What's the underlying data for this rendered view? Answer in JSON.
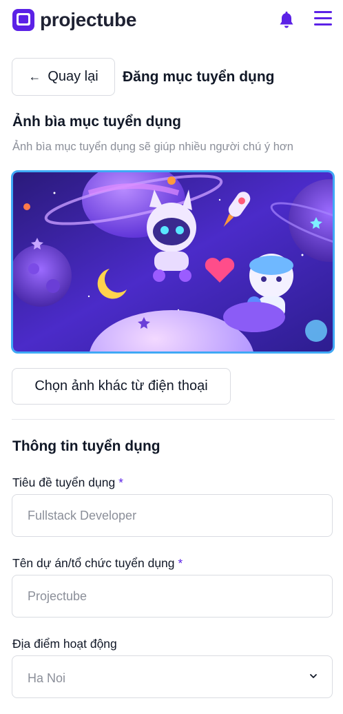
{
  "header": {
    "brand": "projectube",
    "brand_color": "#5b21e6",
    "logo_icon": "projectube-logo-icon",
    "notification_icon": "bell-icon",
    "menu_icon": "hamburger-menu-icon"
  },
  "toolbar": {
    "back_label": "Quay lại",
    "back_icon": "arrow-left-icon",
    "page_title": "Đăng mục tuyển dụng"
  },
  "cover": {
    "title": "Ảnh bìa mục tuyển dụng",
    "subtitle": "Ảnh bìa mục tuyển dụng sẽ giúp nhiều người chú ý hơn",
    "border_color": "#3fa9f5",
    "change_button_label": "Chọn ảnh khác từ điện thoại"
  },
  "form": {
    "section_title": "Thông tin tuyển dụng",
    "required_mark": "*",
    "job_title": {
      "label": "Tiêu đề tuyển dụng",
      "placeholder": "Fullstack Developer",
      "value": ""
    },
    "organization": {
      "label": "Tên dự án/tổ chức tuyển dụng",
      "placeholder": "Projectube",
      "value": ""
    },
    "location": {
      "label": "Địa điểm hoạt động",
      "selected": "Ha Noi",
      "icon": "chevron-down-icon"
    }
  }
}
